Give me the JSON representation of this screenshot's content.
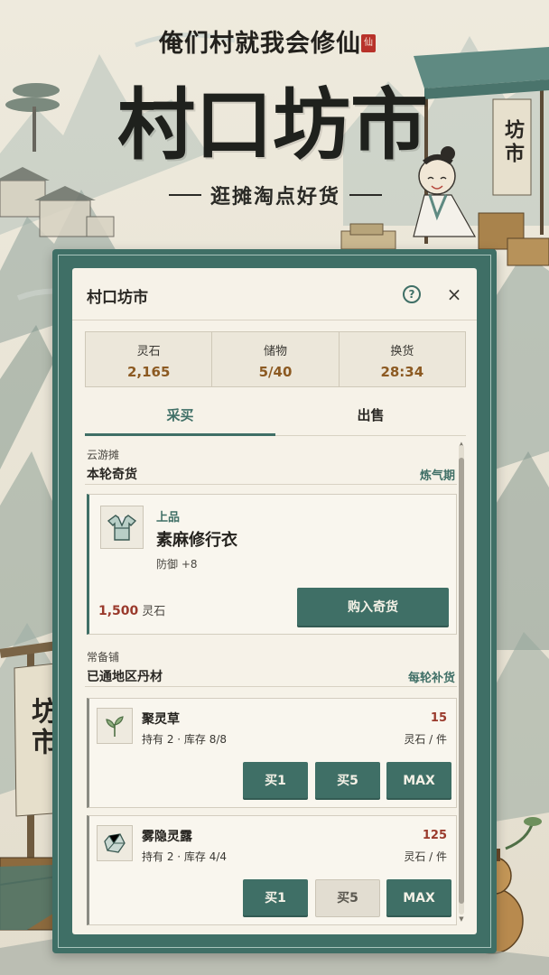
{
  "header": {
    "game_title": "俺们村就我会修仙",
    "seal_char": "仙",
    "hero_title": "村口坊市",
    "subtitle": "逛摊淘点好货",
    "banner_right": "坊市",
    "banner_left": "坊市"
  },
  "panel": {
    "title": "村口坊市",
    "help_label": "?",
    "close_label": "×",
    "stats": [
      {
        "label": "灵石",
        "value": "2,165"
      },
      {
        "label": "储物",
        "value": "5/40"
      },
      {
        "label": "换货",
        "value": "28:34"
      }
    ],
    "tabs": [
      {
        "label": "采买",
        "active": true
      },
      {
        "label": "出售",
        "active": false
      }
    ]
  },
  "featured_section": {
    "kicker": "云游摊",
    "title": "本轮奇货",
    "tag": "炼气期",
    "item": {
      "icon": "robe-icon",
      "quality": "上品",
      "name": "素麻修行衣",
      "stat": "防御 +8",
      "price": "1,500",
      "price_unit": "灵石",
      "buy_label": "购入奇货"
    }
  },
  "regular_section": {
    "kicker": "常备铺",
    "title": "已通地区丹材",
    "tag": "每轮补货",
    "items": [
      {
        "icon": "herb-icon",
        "name": "聚灵草",
        "meta": "持有 2 · 库存 8/8",
        "price": "15",
        "unit": "灵石 / 件",
        "buttons": [
          {
            "label": "买1",
            "enabled": true
          },
          {
            "label": "买5",
            "enabled": true
          },
          {
            "label": "MAX",
            "enabled": true
          }
        ]
      },
      {
        "icon": "crystal-icon",
        "name": "雾隐灵露",
        "meta": "持有 2 · 库存 4/4",
        "price": "125",
        "unit": "灵石 / 件",
        "buttons": [
          {
            "label": "买1",
            "enabled": true
          },
          {
            "label": "买5",
            "enabled": false
          },
          {
            "label": "MAX",
            "enabled": true
          }
        ]
      }
    ]
  },
  "colors": {
    "accent": "#3f6f66",
    "price_red": "#9a3a2c",
    "stat_gold": "#8c5a22",
    "paper": "#f6f2e8"
  }
}
